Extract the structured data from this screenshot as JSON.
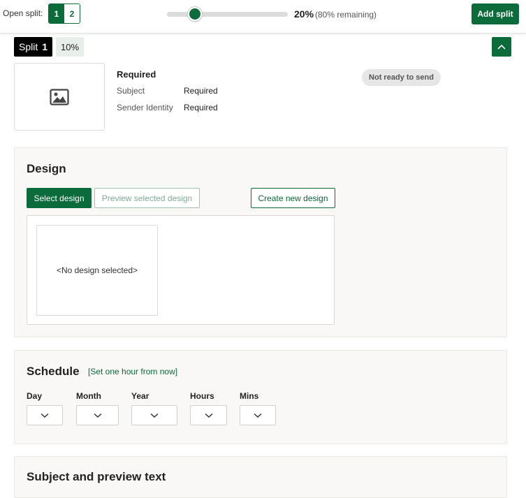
{
  "topbar": {
    "open_split_label": "Open split:",
    "split_buttons": [
      "1",
      "2"
    ],
    "active_split": "1",
    "slider_value_percent": 20,
    "percent_label": "20%",
    "remaining_label": "(80% remaining)",
    "add_split_label": "Add split"
  },
  "split": {
    "tag_label": "Split",
    "tag_number": "1",
    "percent": "10%"
  },
  "summary": {
    "title": "Required",
    "rows": [
      {
        "label": "Subject",
        "value": "Required"
      },
      {
        "label": "Sender Identity",
        "value": "Required"
      }
    ],
    "status_badge": "Not ready to send"
  },
  "design": {
    "title": "Design",
    "select_label": "Select design",
    "preview_label": "Preview selected design",
    "create_label": "Create new design",
    "empty_text": "<No design selected>"
  },
  "schedule": {
    "title": "Schedule",
    "link_label": "[Set one hour from now]",
    "fields": [
      {
        "label": "Day"
      },
      {
        "label": "Month"
      },
      {
        "label": "Year"
      },
      {
        "label": "Hours"
      },
      {
        "label": "Mins"
      }
    ]
  },
  "subject_section": {
    "title": "Subject and preview text"
  },
  "colors": {
    "accent": "#0b6b3a",
    "panel_bg": "#faf8f6",
    "badge_bg": "#e6e6e6"
  },
  "icons": {
    "thumbnail": "image-icon",
    "collapse": "chevron-up-icon",
    "select": "chevron-down-icon"
  }
}
